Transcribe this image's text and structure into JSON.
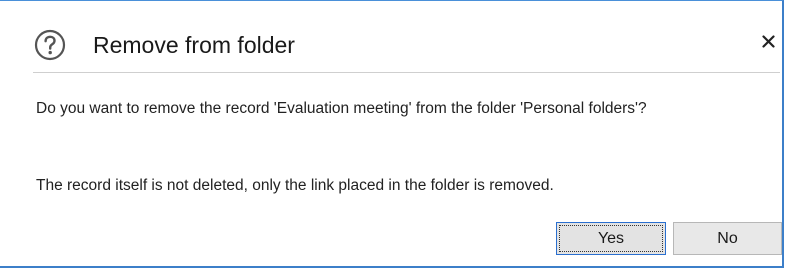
{
  "dialog": {
    "title": "Remove from folder",
    "icon": "question-circle-icon",
    "close_icon": "close-icon",
    "message": "Do you want to remove the record 'Evaluation meeting' from the folder 'Personal folders'?",
    "note": "The record itself is not deleted, only the link placed in the folder is removed.",
    "buttons": {
      "yes_label": "Yes",
      "no_label": "No"
    },
    "colors": {
      "accent_border": "#3c7fc9",
      "focused_button_border": "#2a6fcf"
    }
  }
}
